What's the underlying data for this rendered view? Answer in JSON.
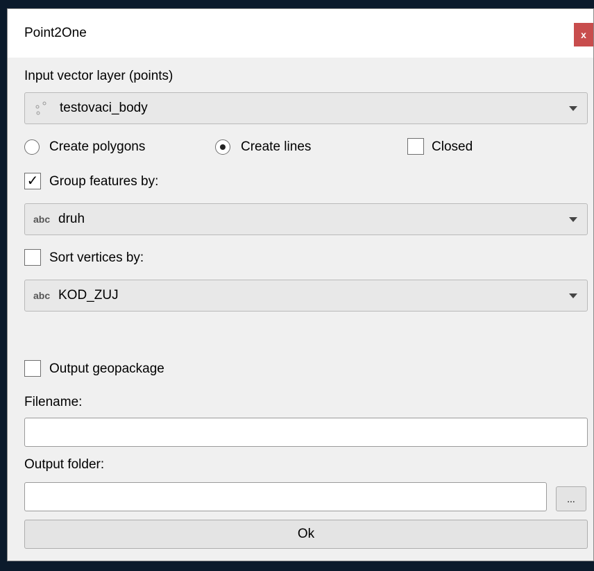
{
  "dialog": {
    "title": "Point2One",
    "close_label": "x"
  },
  "input_layer": {
    "label": "Input vector layer (points)",
    "selected": "testovaci_body"
  },
  "mode": {
    "create_polygons_label": "Create polygons",
    "create_polygons_selected": false,
    "create_lines_label": "Create lines",
    "create_lines_selected": true,
    "closed_label": "Closed",
    "closed_checked": false
  },
  "group": {
    "label": "Group features by:",
    "checked": true,
    "check_mark": "✓",
    "type_badge": "abc",
    "selected": "druh"
  },
  "sort": {
    "label": "Sort vertices by:",
    "checked": false,
    "type_badge": "abc",
    "selected": "KOD_ZUJ"
  },
  "output": {
    "geopackage_label": "Output geopackage",
    "geopackage_checked": false,
    "filename_label": "Filename:",
    "filename_value": "",
    "folder_label": "Output folder:",
    "folder_value": "",
    "browse_label": "...",
    "ok_label": "Ok"
  }
}
